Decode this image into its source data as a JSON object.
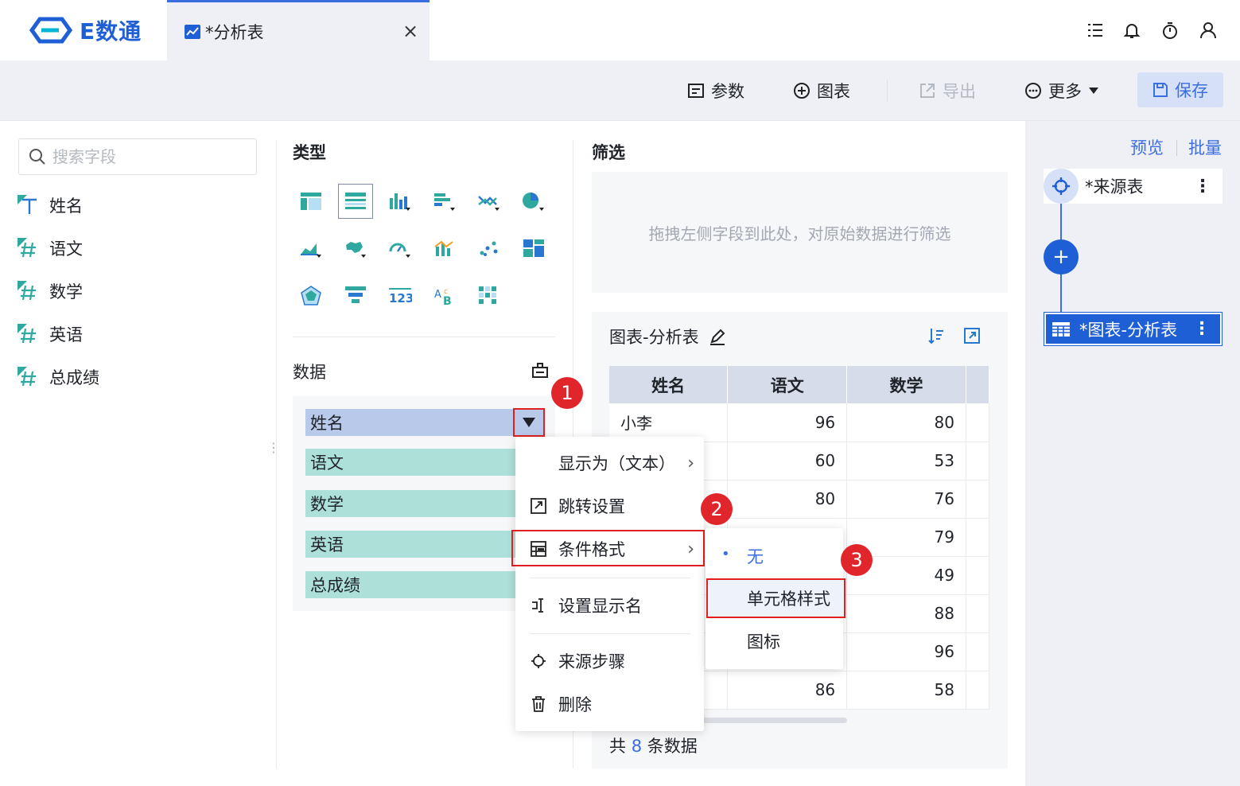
{
  "app": {
    "name": "E数通",
    "tab_title": "*分析表",
    "close_symbol": "×"
  },
  "toolbar": {
    "params": "参数",
    "chart": "图表",
    "export": "导出",
    "more": "更多",
    "save": "保存"
  },
  "left": {
    "search_placeholder": "搜索字段",
    "fields": [
      {
        "name": "姓名",
        "type": "text",
        "icon": "text-field-icon"
      },
      {
        "name": "语文",
        "type": "number",
        "icon": "number-field-icon"
      },
      {
        "name": "数学",
        "type": "number",
        "icon": "number-field-icon"
      },
      {
        "name": "英语",
        "type": "number",
        "icon": "number-field-icon"
      },
      {
        "name": "总成绩",
        "type": "number",
        "icon": "number-field-icon"
      }
    ]
  },
  "type_panel": {
    "title": "类型",
    "data_label": "数据",
    "pills": [
      "姓名",
      "语文",
      "数学",
      "英语",
      "总成绩"
    ]
  },
  "filter": {
    "title": "筛选",
    "hint": "拖拽左侧字段到此处，对原始数据进行筛选"
  },
  "chart": {
    "title": "图表-分析表",
    "headers": [
      "姓名",
      "语文",
      "数学"
    ],
    "rows": [
      [
        "小李",
        "96",
        "80"
      ],
      [
        "",
        "60",
        "53"
      ],
      [
        "",
        "80",
        "76"
      ],
      [
        "",
        "",
        "79"
      ],
      [
        "",
        "",
        "49"
      ],
      [
        "",
        "",
        "88"
      ],
      [
        "",
        "",
        "96"
      ],
      [
        "",
        "86",
        "58"
      ]
    ],
    "footer_prefix": "共",
    "footer_count": "8",
    "footer_suffix": "条数据"
  },
  "steps": {
    "preview": "预览",
    "batch": "批量",
    "source": "*来源表",
    "current": "*图表-分析表",
    "add_symbol": "+"
  },
  "context_menu": {
    "items": [
      "显示为（文本）",
      "跳转设置",
      "条件格式",
      "设置显示名",
      "来源步骤",
      "删除"
    ],
    "submenu": [
      "无",
      "单元格样式",
      "图标"
    ]
  },
  "badges": [
    "1",
    "2",
    "3"
  ],
  "colors": {
    "accent": "#1f5fd6",
    "highlight": "#e02020",
    "dimension_pill": "#b8c9ea",
    "measure_pill": "#ace0d8"
  }
}
